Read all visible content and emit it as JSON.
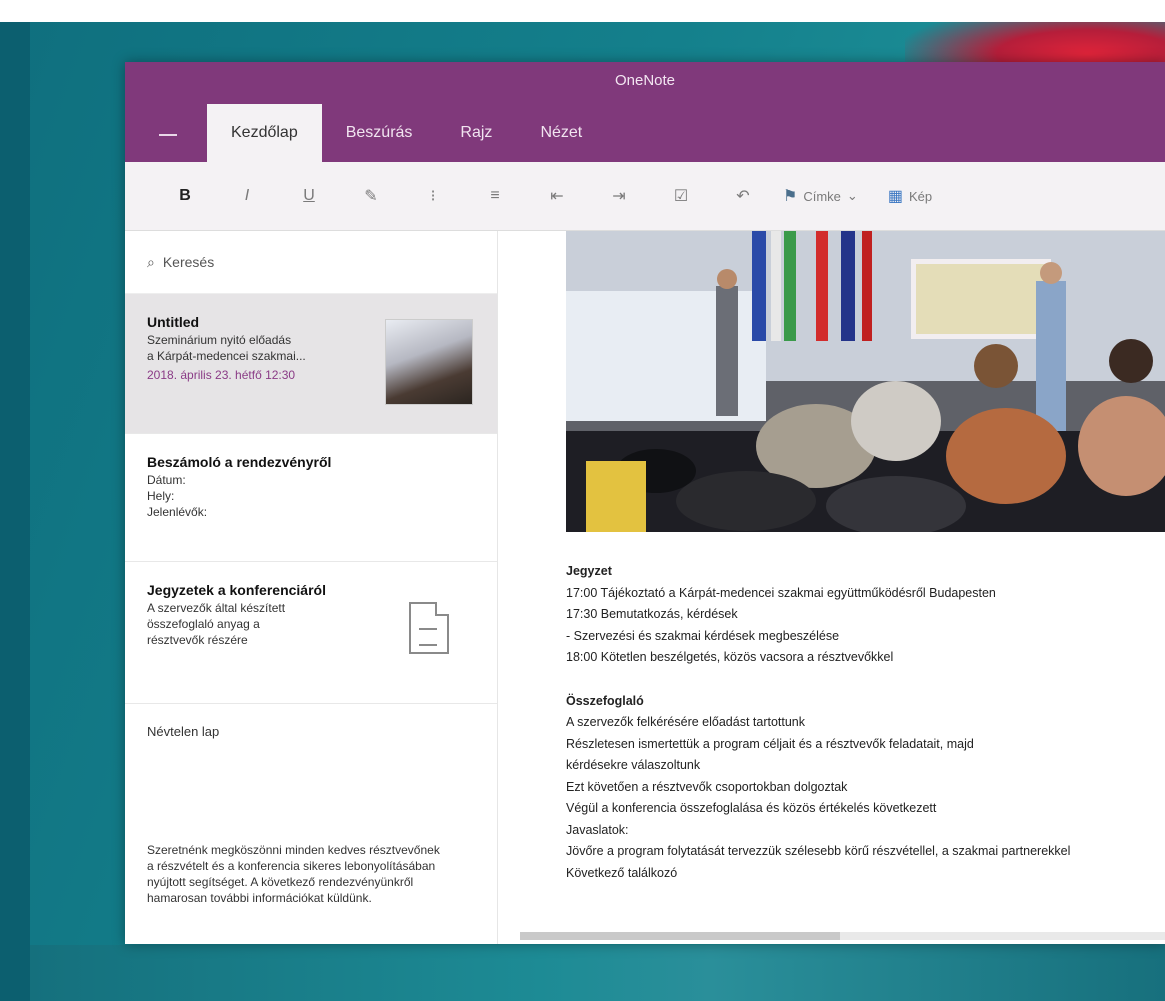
{
  "app": {
    "title": "OneNote"
  },
  "tabs": [
    {
      "label": "Kezdőlap"
    },
    {
      "label": "Beszúrás"
    },
    {
      "label": "Rajz"
    },
    {
      "label": "Nézet"
    }
  ],
  "ribbon": {
    "bold_label": "B",
    "tag_label": "Címke",
    "picture_label": "Kép"
  },
  "sidebar": {
    "search_label": "Keresés",
    "pages": [
      {
        "title": "Untitled",
        "lines": [
          "Szeminárium nyitó előadás",
          "a Kárpát-medencei szakmai..."
        ],
        "date": "2018. április 23. hétfő 12:30"
      },
      {
        "title": "Beszámoló a rendezvényről",
        "lines": [
          "Dátum:",
          "Hely:",
          "Jelenlévők:"
        ]
      },
      {
        "title": "Jegyzetek a konferenciáról",
        "lines": [
          "A szervezők által készített",
          "összefoglaló anyag a",
          "résztvevők részére"
        ]
      },
      {
        "title": "Névtelen lap"
      }
    ],
    "bottom_note": [
      "Szeretnénk megköszönni minden kedves résztvevőnek",
      "a részvételt és a konferencia sikeres lebonyolításában",
      "nyújtott segítséget. A következő rendezvényünkről",
      "hamarosan további információkat küldünk."
    ]
  },
  "note": {
    "heading": "Jegyzet",
    "lines": [
      "17:00 Tájékoztató a Kárpát-medencei szakmai együttműködésről Budapesten",
      "17:30 Bemutatkozás, kérdések",
      "- Szervezési és szakmai kérdések megbeszélése",
      "18:00 Kötetlen beszélgetés, közös vacsora a résztvevőkkel"
    ],
    "section2_heading": "Összefoglaló",
    "section2_lines": [
      "A szervezők felkérésére előadást tartottunk",
      "Részletesen ismertettük a program céljait és a résztvevők feladatait, majd",
      "kérdésekre válaszoltunk",
      "Ezt követően a résztvevők csoportokban dolgoztak",
      "Végül a konferencia összefoglalása és közös értékelés következett",
      "Javaslatok:",
      "Jövőre a program folytatását tervezzük szélesebb körű részvétellel, a szakmai partnerekkel",
      "Következő találkozó"
    ]
  },
  "colors": {
    "accent": "#80397b",
    "ribbon_bg": "#f4f2f4",
    "date_color": "#8a3b86"
  }
}
